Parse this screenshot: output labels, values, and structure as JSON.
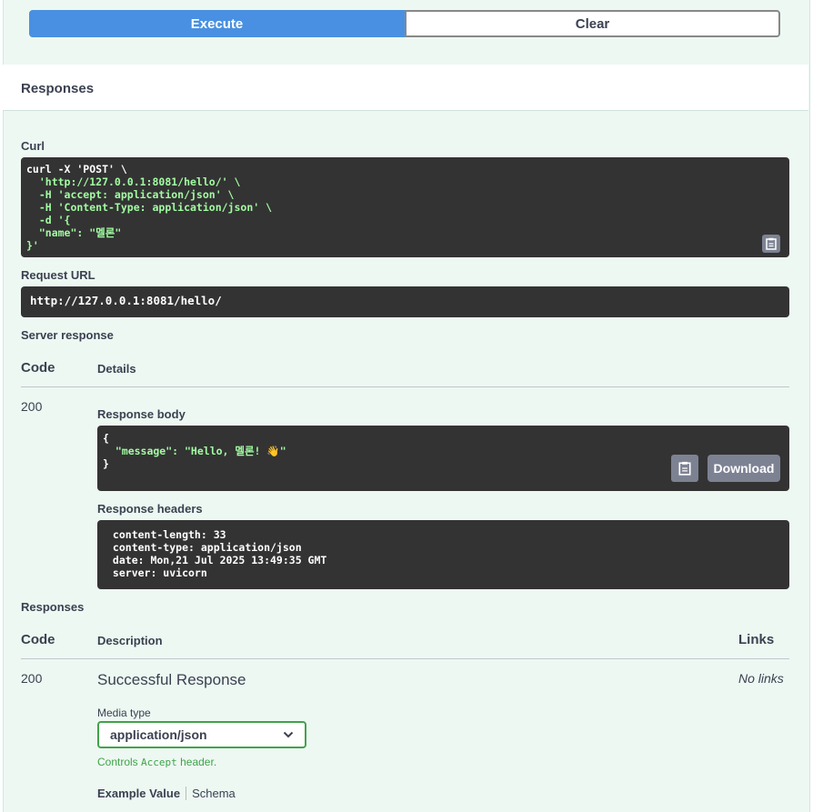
{
  "actions": {
    "execute_label": "Execute",
    "clear_label": "Clear"
  },
  "responses_section": {
    "title": "Responses",
    "curl_label": "Curl",
    "curl_lines": [
      "curl -X 'POST' \\",
      "  'http://127.0.0.1:8081/hello/' \\",
      "  -H 'accept: application/json' \\",
      "  -H 'Content-Type: application/json' \\",
      "  -d '{",
      "  \"name\": \"멜론\"",
      "}'"
    ],
    "request_url_label": "Request URL",
    "request_url": "http://127.0.0.1:8081/hello/",
    "server_response_label": "Server response",
    "code_header": "Code",
    "details_header": "Details",
    "status_code": "200",
    "response_body_label": "Response body",
    "response_body_lines": [
      "{",
      "  \"message\": \"Hello, 멜론! 👋\"",
      "}"
    ],
    "download_label": "Download",
    "response_headers_label": "Response headers",
    "response_headers": [
      " content-length: 33",
      " content-type: application/json",
      " date: Mon,21 Jul 2025 13:49:35 GMT",
      " server: uvicorn"
    ]
  },
  "documented_responses": {
    "title": "Responses",
    "code_header": "Code",
    "description_header": "Description",
    "links_header": "Links",
    "code": "200",
    "description": "Successful Response",
    "links_value": "No links",
    "media_type_label": "Media type",
    "media_type_value": "application/json",
    "controls_text_prefix": "Controls ",
    "controls_text_code": "Accept",
    "controls_text_suffix": " header.",
    "example_value_tab": "Example Value",
    "schema_tab": "Schema"
  },
  "colors": {
    "execute": "#4990e2",
    "panel": "#edf8f2",
    "code_bg": "#333333",
    "accent_green": "#41a34a"
  },
  "icons": [
    "copy-icon",
    "chevron-down-icon"
  ]
}
